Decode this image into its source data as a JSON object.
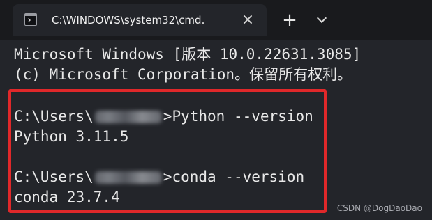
{
  "tab": {
    "title": "C:\\WINDOWS\\system32\\cmd.",
    "icon": "terminal-icon",
    "close_icon": "close-icon"
  },
  "tabbar": {
    "new_tab_label": "+",
    "dropdown_icon": "chevron-down-icon"
  },
  "terminal": {
    "lines": [
      "Microsoft Windows [版本 10.0.22631.3085]",
      "(c) Microsoft Corporation。保留所有权利。",
      "",
      "C:\\Users\\",
      ">Python --version",
      "Python 3.11.5",
      "",
      "C:\\Users\\",
      ">conda --version",
      "conda 23.7.4"
    ]
  },
  "annotation": {
    "highlight_color": "#e0282a"
  },
  "watermark": "CSDN @DogDaoDao"
}
